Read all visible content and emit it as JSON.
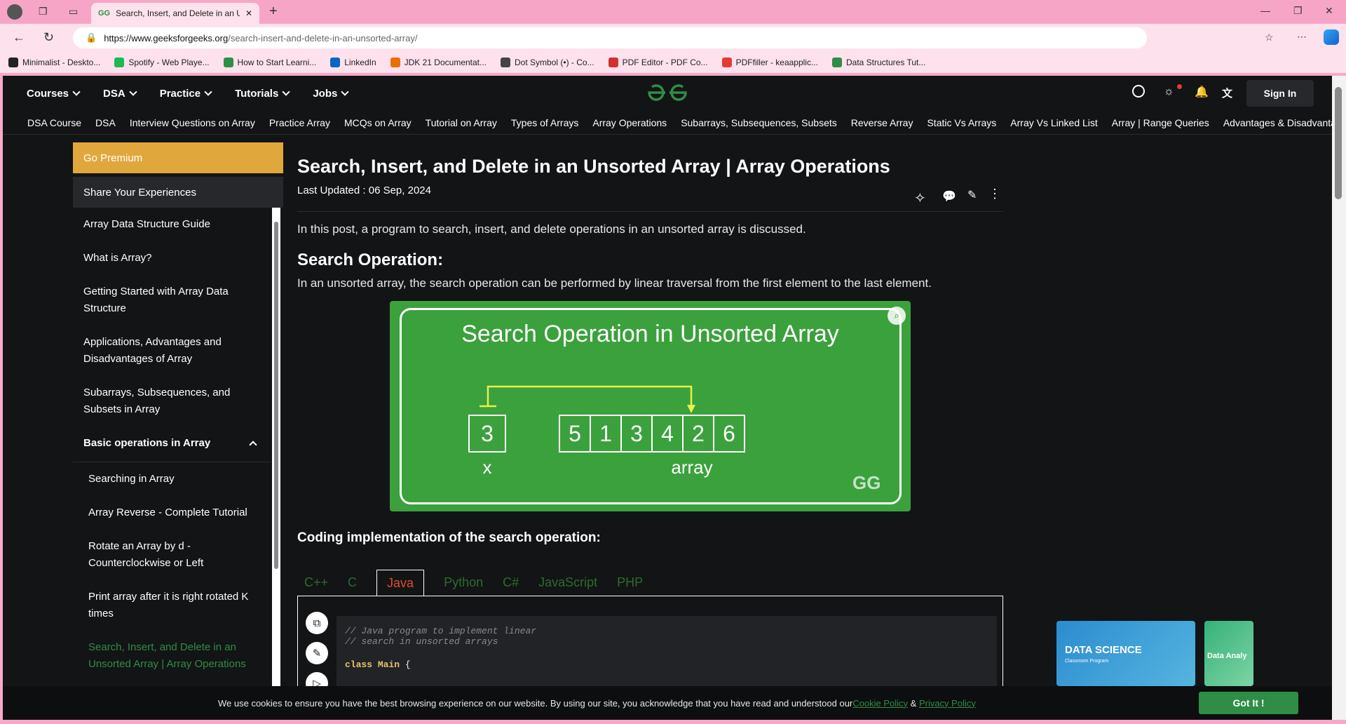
{
  "browser": {
    "tab_title": "Search, Insert, and Delete in an Unsorted Array | Array Operations",
    "url_host": "https://www.geeksforgeeks.org",
    "url_path": "/search-insert-and-delete-in-an-unsorted-array/",
    "bookmarks": [
      {
        "label": "Minimalist - Deskto...",
        "color": "#222222"
      },
      {
        "label": "Spotify - Web Playe...",
        "color": "#1db954"
      },
      {
        "label": "How to Start Learni...",
        "color": "#2f8d46"
      },
      {
        "label": "LinkedIn",
        "color": "#0a66c2"
      },
      {
        "label": "JDK 21 Documentat...",
        "color": "#e76f00"
      },
      {
        "label": "Dot Symbol (•) - Co...",
        "color": "#444444"
      },
      {
        "label": "PDF Editor - PDF Co...",
        "color": "#d32f2f"
      },
      {
        "label": "PDFfiller - keaapplic...",
        "color": "#e53935"
      },
      {
        "label": "Data Structures Tut...",
        "color": "#2f8d46"
      }
    ]
  },
  "nav": {
    "items": [
      "Courses",
      "DSA",
      "Practice",
      "Tutorials",
      "Jobs"
    ],
    "sign_in": "Sign In",
    "logo": "GfG"
  },
  "subnav": [
    "DSA Course",
    "DSA",
    "Interview Questions on Array",
    "Practice Array",
    "MCQs on Array",
    "Tutorial on Array",
    "Types of Arrays",
    "Array Operations",
    "Subarrays, Subsequences, Subsets",
    "Reverse Array",
    "Static Vs Arrays",
    "Array Vs Linked List",
    "Array | Range Queries",
    "Advantages & Disadvantages"
  ],
  "sidebar": {
    "premium": "Go Premium",
    "share": "Share Your Experiences",
    "items": [
      "Array Data Structure Guide",
      "What is Array?",
      "Getting Started with Array Data Structure",
      "Applications, Advantages and Disadvantages of Array",
      "Subarrays, Subsequences, and Subsets in Array"
    ],
    "section": "Basic operations in Array",
    "sub_items": [
      "Searching in Array",
      "Array Reverse - Complete Tutorial",
      "Rotate an Array by d - Counterclockwise or Left",
      "Print array after it is right rotated K times",
      "Search, Insert, and Delete in an Unsorted Array | Array Operations"
    ]
  },
  "article": {
    "title": "Search, Insert, and Delete in an Unsorted Array | Array Operations",
    "updated": "Last Updated : 06 Sep, 2024",
    "intro": "In this post, a program to search, insert, and delete operations in an unsorted array is discussed.",
    "search_heading": "Search Operation:",
    "search_text": "In an unsorted array, the search operation can be performed by linear traversal from the first element to the last element.",
    "figure": {
      "title": "Search Operation in Unsorted Array",
      "x_value": "3",
      "x_label": "x",
      "array": [
        "5",
        "1",
        "3",
        "4",
        "2",
        "6"
      ],
      "array_label": "array",
      "watermark": "GG"
    },
    "code_heading": "Coding implementation of the search operation:",
    "code_tabs": [
      "C++",
      "C",
      "Java",
      "Python",
      "C#",
      "JavaScript",
      "PHP"
    ],
    "active_tab": "Java",
    "code": {
      "line1": "// Java program to implement linear",
      "line2": "// search in unsorted arrays",
      "kw": "class",
      "cls": "Main",
      "brace": "{"
    }
  },
  "ads": {
    "ad1_title": "DATA SCIENCE",
    "ad1_sub": "Classroom Program",
    "ad2_title": "Data Analy"
  },
  "cookie": {
    "text": "We use cookies to ensure you have the best browsing experience on our website. By using our site, you acknowledge that you have read and understood our ",
    "cookie_policy": "Cookie Policy",
    "amp": " & ",
    "privacy_policy": "Privacy Policy",
    "button": "Got It !"
  },
  "colors": {
    "brand": "#2f8d46",
    "premium": "#e0a83c",
    "figure": "#3ba13c"
  }
}
